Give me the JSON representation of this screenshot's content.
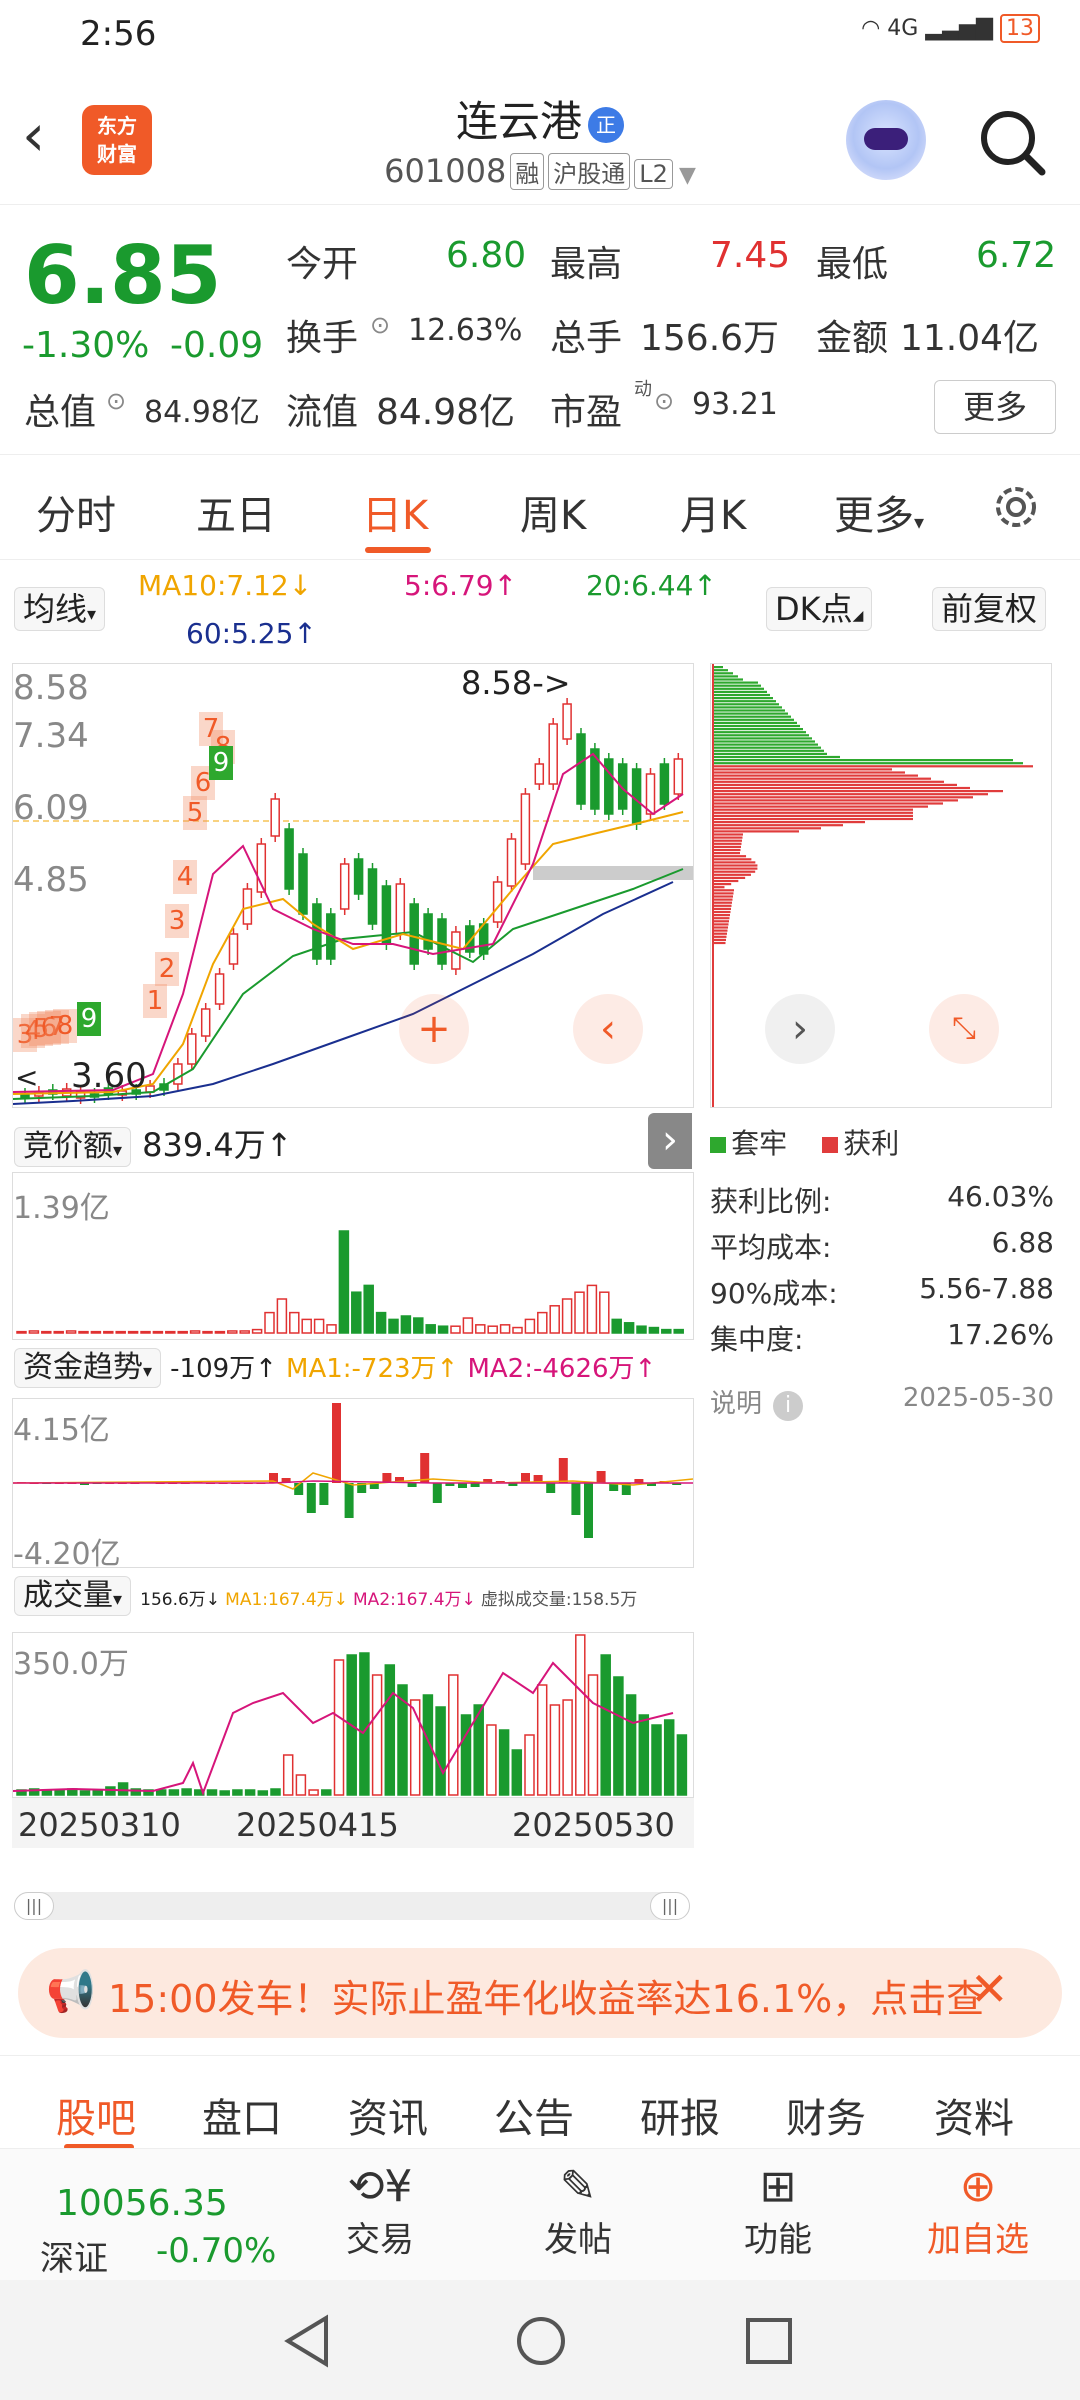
{
  "status": {
    "time": "2:56",
    "network": "4G",
    "battery": "13"
  },
  "header": {
    "back_icon": "chevron-left-icon",
    "logo_text_1": "东方",
    "logo_text_2": "财富",
    "stock_name": "连云港",
    "tag": "正",
    "code": "601008",
    "badge_rong": "融",
    "badge_hgt": "沪股通",
    "badge_l2": "L2"
  },
  "quote": {
    "price": "6.85",
    "change_pct": "-1.30%",
    "change": "-0.09",
    "open_label": "今开",
    "open": "6.80",
    "high_label": "最高",
    "high": "7.45",
    "low_label": "最低",
    "low": "6.72",
    "turnover_label": "换手",
    "turnover": "12.63%",
    "volume_label": "总手",
    "volume": "156.6万",
    "amount_label": "金额",
    "amount": "11.04亿",
    "mcap_label": "总值",
    "mcap": "84.98亿",
    "float_label": "流值",
    "float": "84.98亿",
    "pe_label": "市盈",
    "pe_sup": "动",
    "pe": "93.21",
    "more": "更多"
  },
  "tabs": [
    "分时",
    "五日",
    "日K",
    "周K",
    "月K",
    "更多"
  ],
  "ma": {
    "type": "均线",
    "ma10": "MA10:7.12↓",
    "ma5": "5:6.79↑",
    "ma20": "20:6.44↑",
    "ma60": "60:5.25↑",
    "dk": "DK点",
    "adjust": "前复权"
  },
  "kline": {
    "axis": [
      "8.58",
      "7.34",
      "6.09",
      "4.85"
    ],
    "high_mark": "8.58->",
    "low_mark": "3.60",
    "low_prefix": "<",
    "seq_low": [
      "3",
      "4",
      "5",
      "6",
      "7",
      "8",
      "9"
    ],
    "seq_up": [
      "1",
      "2",
      "3",
      "4",
      "5",
      "6",
      "7",
      "8",
      "9"
    ]
  },
  "distribution": {
    "legend_trapped": "套牢",
    "legend_profit": "获利",
    "rows": [
      {
        "label": "获利比例:",
        "value": "46.03%"
      },
      {
        "label": "平均成本:",
        "value": "6.88"
      },
      {
        "label": "90%成本:",
        "value": "5.56-7.88"
      },
      {
        "label": "集中度:",
        "value": "17.26%"
      }
    ],
    "note": "说明",
    "date": "2025-05-30"
  },
  "auction": {
    "label": "竞价额",
    "value": "839.4万↑",
    "axis_top": "1.39亿"
  },
  "fundflow": {
    "label": "资金趋势",
    "value": "-109万↑",
    "ma1": "MA1:-723万↑",
    "ma2": "MA2:-4626万↑",
    "axis_top": "4.15亿",
    "axis_bottom": "-4.20亿"
  },
  "volume": {
    "label": "成交量",
    "value": "156.6万↓",
    "ma1": "MA1:167.4万↓",
    "ma2": "MA2:167.4万↓",
    "virtual": "虚拟成交量:158.5万",
    "axis_top": "350.0万",
    "dates": [
      "20250310",
      "20250415",
      "20250530"
    ]
  },
  "banner": {
    "text": "15:00发车！实际止盈年化收益率达16.1%，点击查"
  },
  "bottom_tabs": [
    "股吧",
    "盘口",
    "资讯",
    "公告",
    "研报",
    "财务",
    "资料"
  ],
  "footer": {
    "index_value": "10056.35",
    "index_name": "深证",
    "index_change": "-0.70%",
    "items": [
      {
        "label": "交易",
        "icon": "yuan-exchange-icon"
      },
      {
        "label": "发帖",
        "icon": "edit-icon"
      },
      {
        "label": "功能",
        "icon": "grid-icon"
      },
      {
        "label": "加自选",
        "icon": "plus-circle-icon"
      }
    ]
  },
  "colors": {
    "accent": "#f05a28",
    "up": "#e03131",
    "down": "#1a9a2e",
    "ma5": "#d6157a",
    "ma10": "#f0a500",
    "ma20": "#1a9a2e",
    "ma60": "#1a2f8f"
  }
}
